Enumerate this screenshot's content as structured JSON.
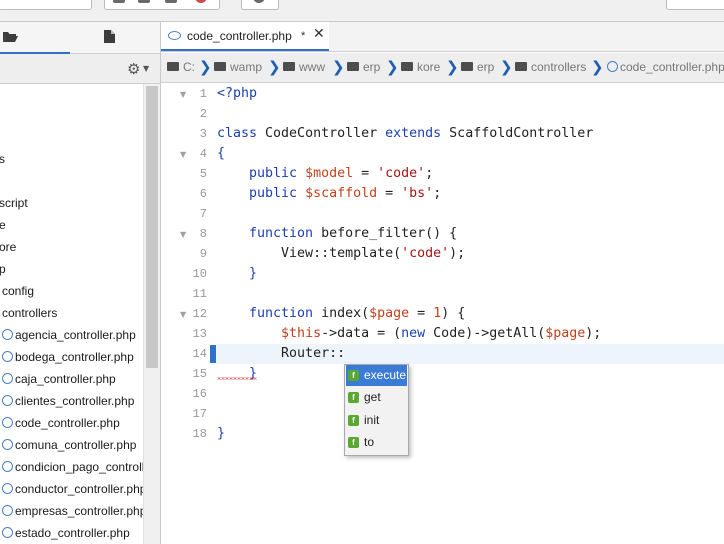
{
  "editor": {
    "tab_label": "code_controller.php",
    "tab_dirty": "*",
    "tab_close": "✕"
  },
  "breadcrumb": [
    "C:",
    "wamp",
    "www",
    "erp",
    "kore",
    "erp",
    "controllers",
    "code_controller.php"
  ],
  "left_panel": {
    "tabs": [
      "folder-open-icon",
      "file-icon"
    ],
    "settings_icon": "gear-icon"
  },
  "tree": [
    {
      "label": "s",
      "type": "folder"
    },
    {
      "label": "script",
      "type": "folder"
    },
    {
      "label": "e",
      "type": "folder"
    },
    {
      "label": "ore",
      "type": "folder"
    },
    {
      "label": "p",
      "type": "folder"
    },
    {
      "label": "config",
      "type": "folder"
    },
    {
      "label": "controllers",
      "type": "folder"
    },
    {
      "label": "agencia_controller.php",
      "type": "php"
    },
    {
      "label": "bodega_controller.php",
      "type": "php"
    },
    {
      "label": "caja_controller.php",
      "type": "php"
    },
    {
      "label": "clientes_controller.php",
      "type": "php"
    },
    {
      "label": "code_controller.php",
      "type": "php"
    },
    {
      "label": "comuna_controller.php",
      "type": "php"
    },
    {
      "label": "condicion_pago_controll...",
      "type": "php"
    },
    {
      "label": "conductor_controller.php",
      "type": "php"
    },
    {
      "label": "empresas_controller.php",
      "type": "php"
    },
    {
      "label": "estado_controller.php",
      "type": "php"
    }
  ],
  "line_numbers": [
    "1",
    "2",
    "3",
    "4",
    "5",
    "6",
    "7",
    "8",
    "9",
    "10",
    "11",
    "12",
    "13",
    "14",
    "15",
    "16",
    "17",
    "18"
  ],
  "code": {
    "l1": "<?php",
    "l3a": "class",
    "l3b": " CodeController ",
    "l3c": "extends",
    "l3d": " ScaffoldController",
    "l4": "{",
    "l5a": "    public ",
    "l5b": "$model",
    "l5c": " = ",
    "l5d": "'code'",
    "l5e": ";",
    "l6a": "    public ",
    "l6b": "$scaffold",
    "l6c": " = ",
    "l6d": "'bs'",
    "l6e": ";",
    "l8a": "    function",
    "l8b": " before_filter() {",
    "l9a": "        View::template(",
    "l9b": "'code'",
    "l9c": ");",
    "l10": "    }",
    "l12a": "    function",
    "l12b": " index(",
    "l12c": "$page",
    "l12d": " = ",
    "l12e": "1",
    "l12f": ") {",
    "l13a": "        ",
    "l13b": "$this",
    "l13c": "->data = (",
    "l13d": "new",
    "l13e": " Code)->getAll(",
    "l13f": "$page",
    "l13g": ");",
    "l14": "        Router::",
    "l15": "    }",
    "l18": "}"
  },
  "autocomplete": [
    "execute",
    "get",
    "init",
    "to"
  ],
  "autocomplete_badge": "f",
  "colors": {
    "accent": "#2f70c9",
    "keyword": "#1c3fb0",
    "variable": "#c2411c",
    "string": "#a31515",
    "method_badge": "#5aa832"
  }
}
